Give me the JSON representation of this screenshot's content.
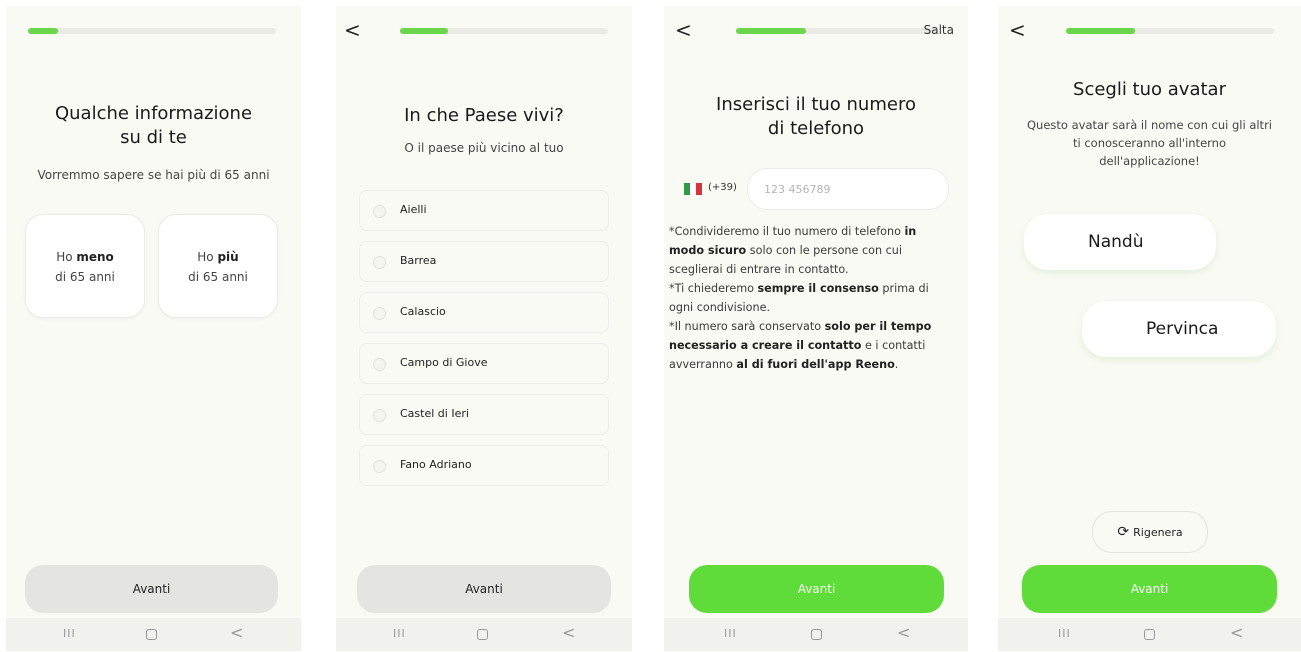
{
  "screen1": {
    "progress": 0.12,
    "title_line1": "Qualche informazione",
    "title_line2": "su di te",
    "subtitle": "Vorremmo sapere se hai più di 65 anni",
    "option_under": {
      "pre": "Ho ",
      "bold": "meno",
      "post": " di 65 anni"
    },
    "option_over": {
      "pre": "Ho ",
      "bold": "più",
      "post": " di 65 anni"
    },
    "button": "Avanti"
  },
  "screen2": {
    "progress": 0.23,
    "back_icon": "chevron-left-icon",
    "back": "<",
    "title": "In che Paese vivi?",
    "subtitle": "O il paese più vicino al tuo",
    "options": [
      "Aielli",
      "Barrea",
      "Calascio",
      "Campo di Giove",
      "Castel di Ieri",
      "Fano Adriano"
    ],
    "button": "Avanti"
  },
  "screen3": {
    "progress": 0.35,
    "back_icon": "chevron-left-icon",
    "back": "<",
    "skip": "Salta",
    "title_line1": "Inserisci il tuo numero",
    "title_line2": "di telefono",
    "flag_icon": "italy-flag-icon",
    "prefix": "(+39)",
    "phone_placeholder": "123 456789",
    "note1": {
      "a": "*Condivideremo il tuo numero di telefono ",
      "b": "in modo sicuro",
      "c": " solo con le persone con cui sceglierai di entrare in contatto."
    },
    "note2": {
      "a": "*Ti chiederemo ",
      "b": "sempre il consenso",
      "c": " prima di ogni condivisione."
    },
    "note3": {
      "a": "*Il numero sarà conservato ",
      "b": "solo per il tempo necessario a creare il contatto",
      "c": " e i contatti avverranno ",
      "d": "al di fuori dell'app Reeno",
      "e": "."
    },
    "button": "Avanti",
    "colors": {
      "accent": "#5fdc3a"
    }
  },
  "screen4": {
    "progress": 0.33,
    "back_icon": "chevron-left-icon",
    "back": "<",
    "title": "Scegli tuo avatar",
    "description_line1": "Questo avatar sarà il nome con cui gli altri",
    "description_line2": "ti conosceranno all'interno",
    "description_line3": "dell'applicazione!",
    "avatar1": "Nandù",
    "avatar2": "Pervinca",
    "regen_icon": "refresh-icon",
    "regen_label": "Rigenera",
    "button": "Avanti"
  },
  "navbar": {
    "recent": "III",
    "back": "<"
  }
}
